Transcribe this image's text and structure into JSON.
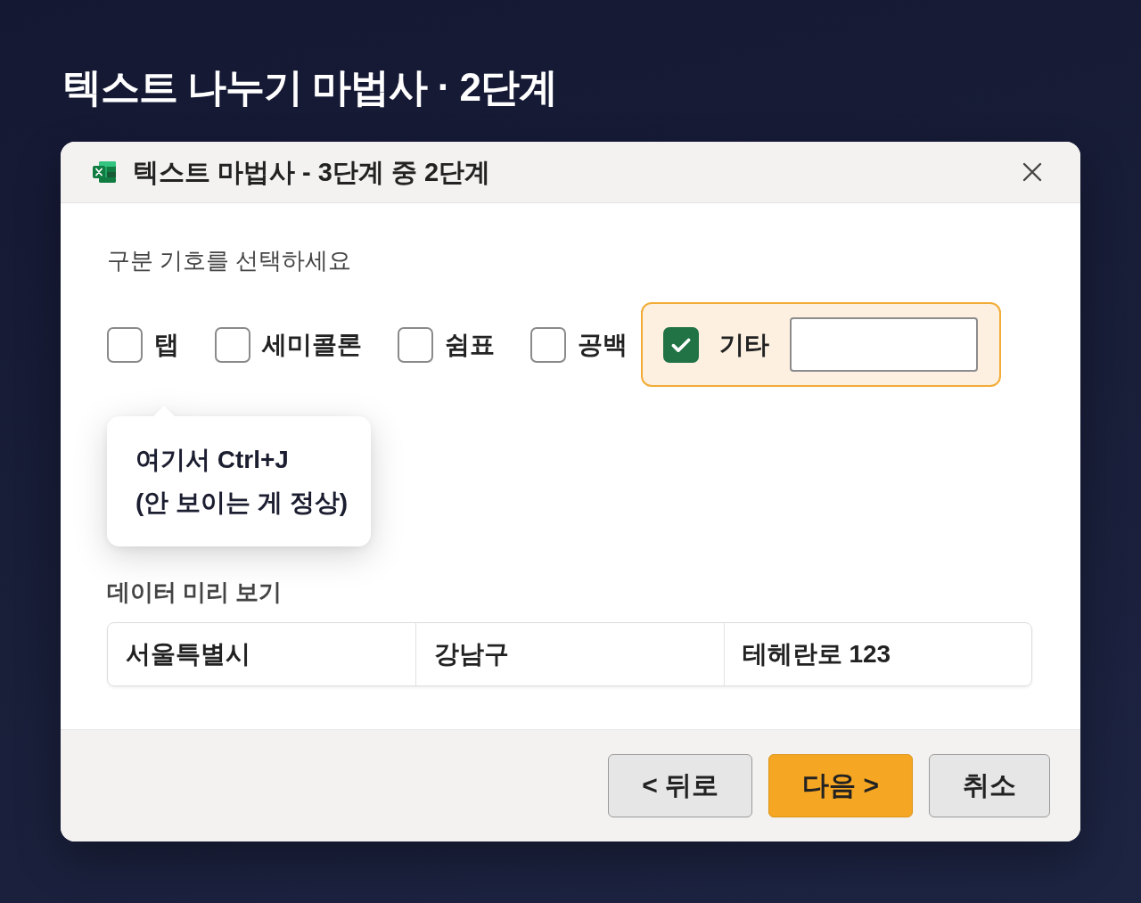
{
  "page_title": "텍스트 나누기 마법사 · 2단계",
  "dialog": {
    "title": "텍스트 마법사 - 3단계 중 2단계"
  },
  "delimiters": {
    "heading": "구분 기호를 선택하세요",
    "options": [
      {
        "kind": "checkbox",
        "label": "탭",
        "checked": false,
        "highlighted": false
      },
      {
        "kind": "checkbox",
        "label": "세미콜론",
        "checked": false,
        "highlighted": false
      },
      {
        "kind": "checkbox",
        "label": "쉼표",
        "checked": false,
        "highlighted": false
      },
      {
        "kind": "checkbox",
        "label": "공백",
        "checked": false,
        "highlighted": false
      },
      {
        "kind": "checkbox-field",
        "label": "기타",
        "checked": true,
        "highlighted": true
      }
    ]
  },
  "tooltip": {
    "lines": [
      "여기서 Ctrl+J",
      "(안 보이는 게 정상)"
    ]
  },
  "preview": {
    "heading": "데이터 미리 보기",
    "rows": [
      [
        "서울특별시",
        "강남구",
        "테헤란로 123"
      ]
    ]
  },
  "buttons": [
    {
      "kind": "secondary",
      "label": "< 뒤로"
    },
    {
      "kind": "primary",
      "label": "다음 >"
    },
    {
      "kind": "secondary",
      "label": "취소"
    }
  ]
}
